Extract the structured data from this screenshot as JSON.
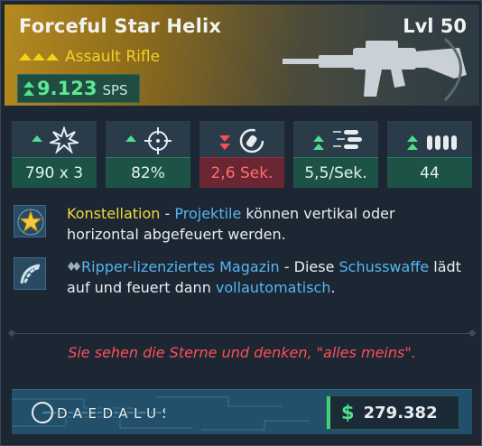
{
  "item": {
    "name": "Forceful Star Helix",
    "level": "Lvl 50",
    "type": "Assault Rifle",
    "rarity_chevrons": 3,
    "sps_value": "9.123",
    "sps_unit": "SPS"
  },
  "stats": [
    {
      "icon": "damage-burst-icon",
      "value": "790 x 3",
      "trend": "up",
      "arrows": 1
    },
    {
      "icon": "crosshair-icon",
      "value": "82%",
      "trend": "up",
      "arrows": 1
    },
    {
      "icon": "reload-timer-icon",
      "value": "2,6 Sek.",
      "trend": "down",
      "arrows": 2
    },
    {
      "icon": "fire-rate-bullets-icon",
      "value": "5,5/Sek.",
      "trend": "up",
      "arrows": 2
    },
    {
      "icon": "magazine-icon",
      "value": "44",
      "trend": "up",
      "arrows": 2
    }
  ],
  "perks": {
    "constellation": {
      "name": "Konstellation",
      "sep": " - ",
      "link": "Projektile",
      "text": " können vertikal oder horizontal abgefeuert werden."
    },
    "ripper": {
      "name": "Ripper-lizenziertes Magazin",
      "sep": " - Diese ",
      "link1": "Schusswaffe",
      "mid": " lädt auf und feuert dann ",
      "link2": "vollautomatisch",
      "end": "."
    }
  },
  "flavor_text": "Sie sehen die Sterne und denken, \"alles meins\".",
  "manufacturer": "DAEDALUS",
  "price": {
    "currency_symbol": "$",
    "value": "279.382"
  },
  "colors": {
    "accent_up": "#4fe08a",
    "accent_down": "#ff4a5a",
    "rarity": "#f3d226",
    "link": "#55b6f0",
    "flavor": "#ff4f5a"
  }
}
